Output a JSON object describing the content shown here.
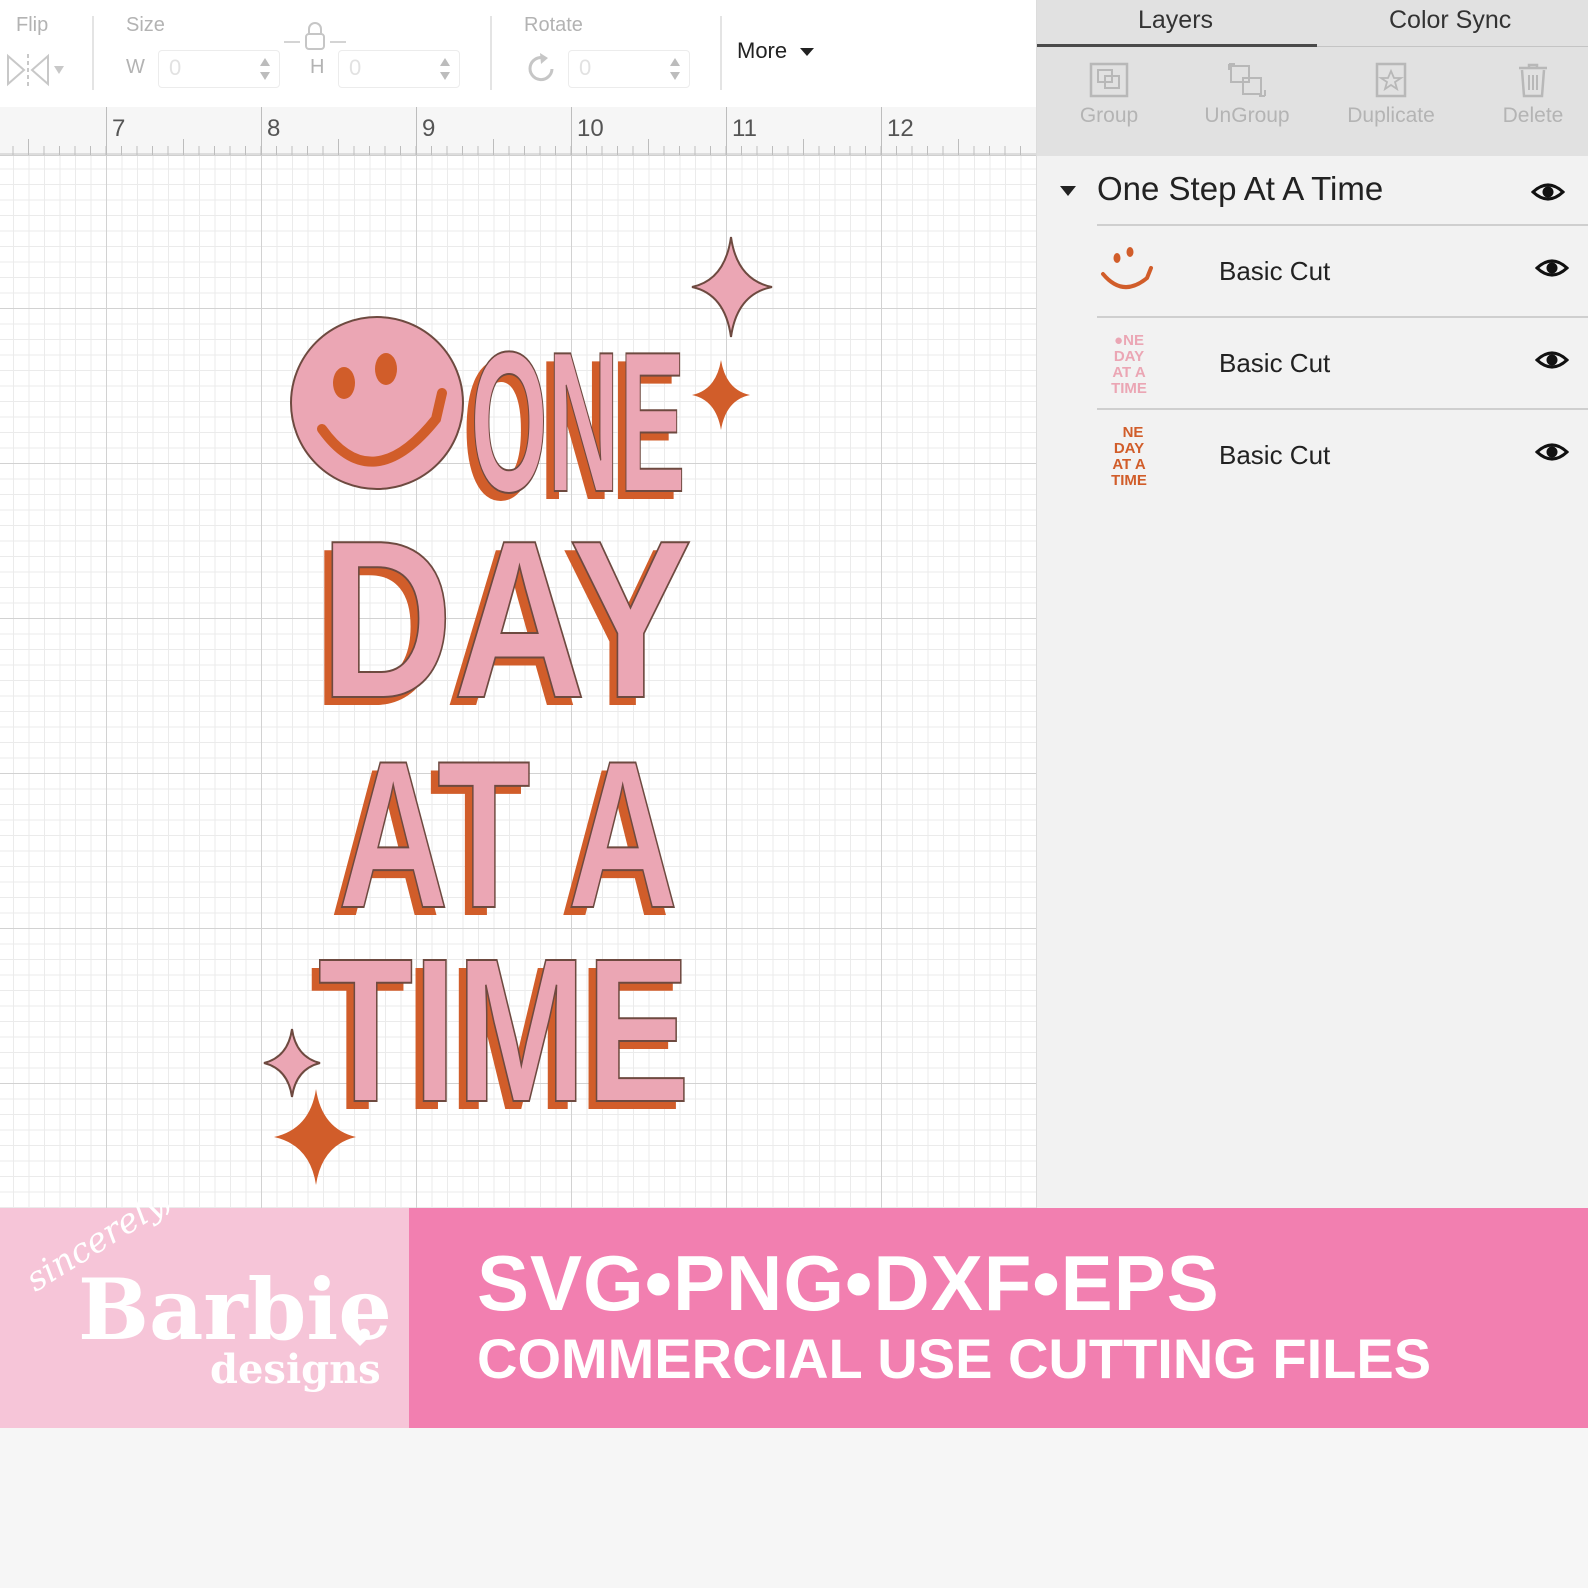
{
  "toolbar": {
    "flip_label": "Flip",
    "size_label": "Size",
    "w_label": "W",
    "w_value": "0",
    "h_label": "H",
    "h_value": "0",
    "rotate_label": "Rotate",
    "rotate_value": "0",
    "more_label": "More"
  },
  "ruler": {
    "numbers": [
      "7",
      "8",
      "9",
      "10",
      "11",
      "12"
    ]
  },
  "design": {
    "line1": "ONE",
    "line2": "DAY",
    "line3": "AT A",
    "line4": "TIME",
    "colors": {
      "pink": "#eba6b4",
      "rust": "#d15d2a",
      "outline": "#6e4a40"
    }
  },
  "panel": {
    "tabs": [
      "Layers",
      "Color Sync"
    ],
    "active_tab": "Layers",
    "actions": [
      {
        "label": "Group",
        "icon": "group-icon"
      },
      {
        "label": "UnGroup",
        "icon": "ungroup-icon"
      },
      {
        "label": "Duplicate",
        "icon": "duplicate-icon"
      },
      {
        "label": "Delete",
        "icon": "delete-icon"
      }
    ],
    "group_title": "One Step At A Time",
    "layers": [
      {
        "label": "Basic Cut",
        "thumb": "smiley-thumbnail",
        "visible": true
      },
      {
        "label": "Basic Cut",
        "thumb": "pink-text-thumbnail",
        "visible": true
      },
      {
        "label": "Basic Cut",
        "thumb": "rust-text-thumbnail",
        "visible": true
      }
    ]
  },
  "banner": {
    "formats": "SVG•PNG•DXF•EPS",
    "usage": "COMMERCIAL USE CUTTING FILES",
    "brand": {
      "sincerely": "sincerely,",
      "name": "Barbie",
      "designs": "designs"
    },
    "colors": {
      "left": "#f6c5d8",
      "right": "#f27fb0"
    }
  }
}
